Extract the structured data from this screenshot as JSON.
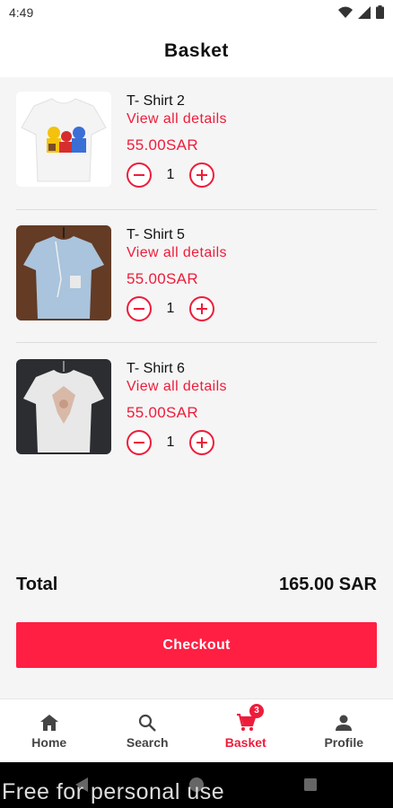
{
  "status": {
    "time": "4:49"
  },
  "header": {
    "title": "Basket"
  },
  "items": [
    {
      "name": "T- Shirt 2",
      "details_link": "View all details",
      "price": "55.00SAR",
      "quantity": "1"
    },
    {
      "name": "T- Shirt 5",
      "details_link": "View all details",
      "price": "55.00SAR",
      "quantity": "1"
    },
    {
      "name": "T- Shirt 6",
      "details_link": "View all details",
      "price": "55.00SAR",
      "quantity": "1"
    }
  ],
  "summary": {
    "total_label": "Total",
    "total_value": "165.00 SAR"
  },
  "checkout": {
    "label": "Checkout"
  },
  "nav": [
    {
      "label": "Home",
      "icon": "home-icon"
    },
    {
      "label": "Search",
      "icon": "search-icon"
    },
    {
      "label": "Basket",
      "icon": "cart-icon",
      "badge": "3",
      "active": true
    },
    {
      "label": "Profile",
      "icon": "person-icon"
    }
  ],
  "watermark": "Free for personal use",
  "colors": {
    "accent": "#ee1c3a",
    "button": "#ff1f43"
  }
}
